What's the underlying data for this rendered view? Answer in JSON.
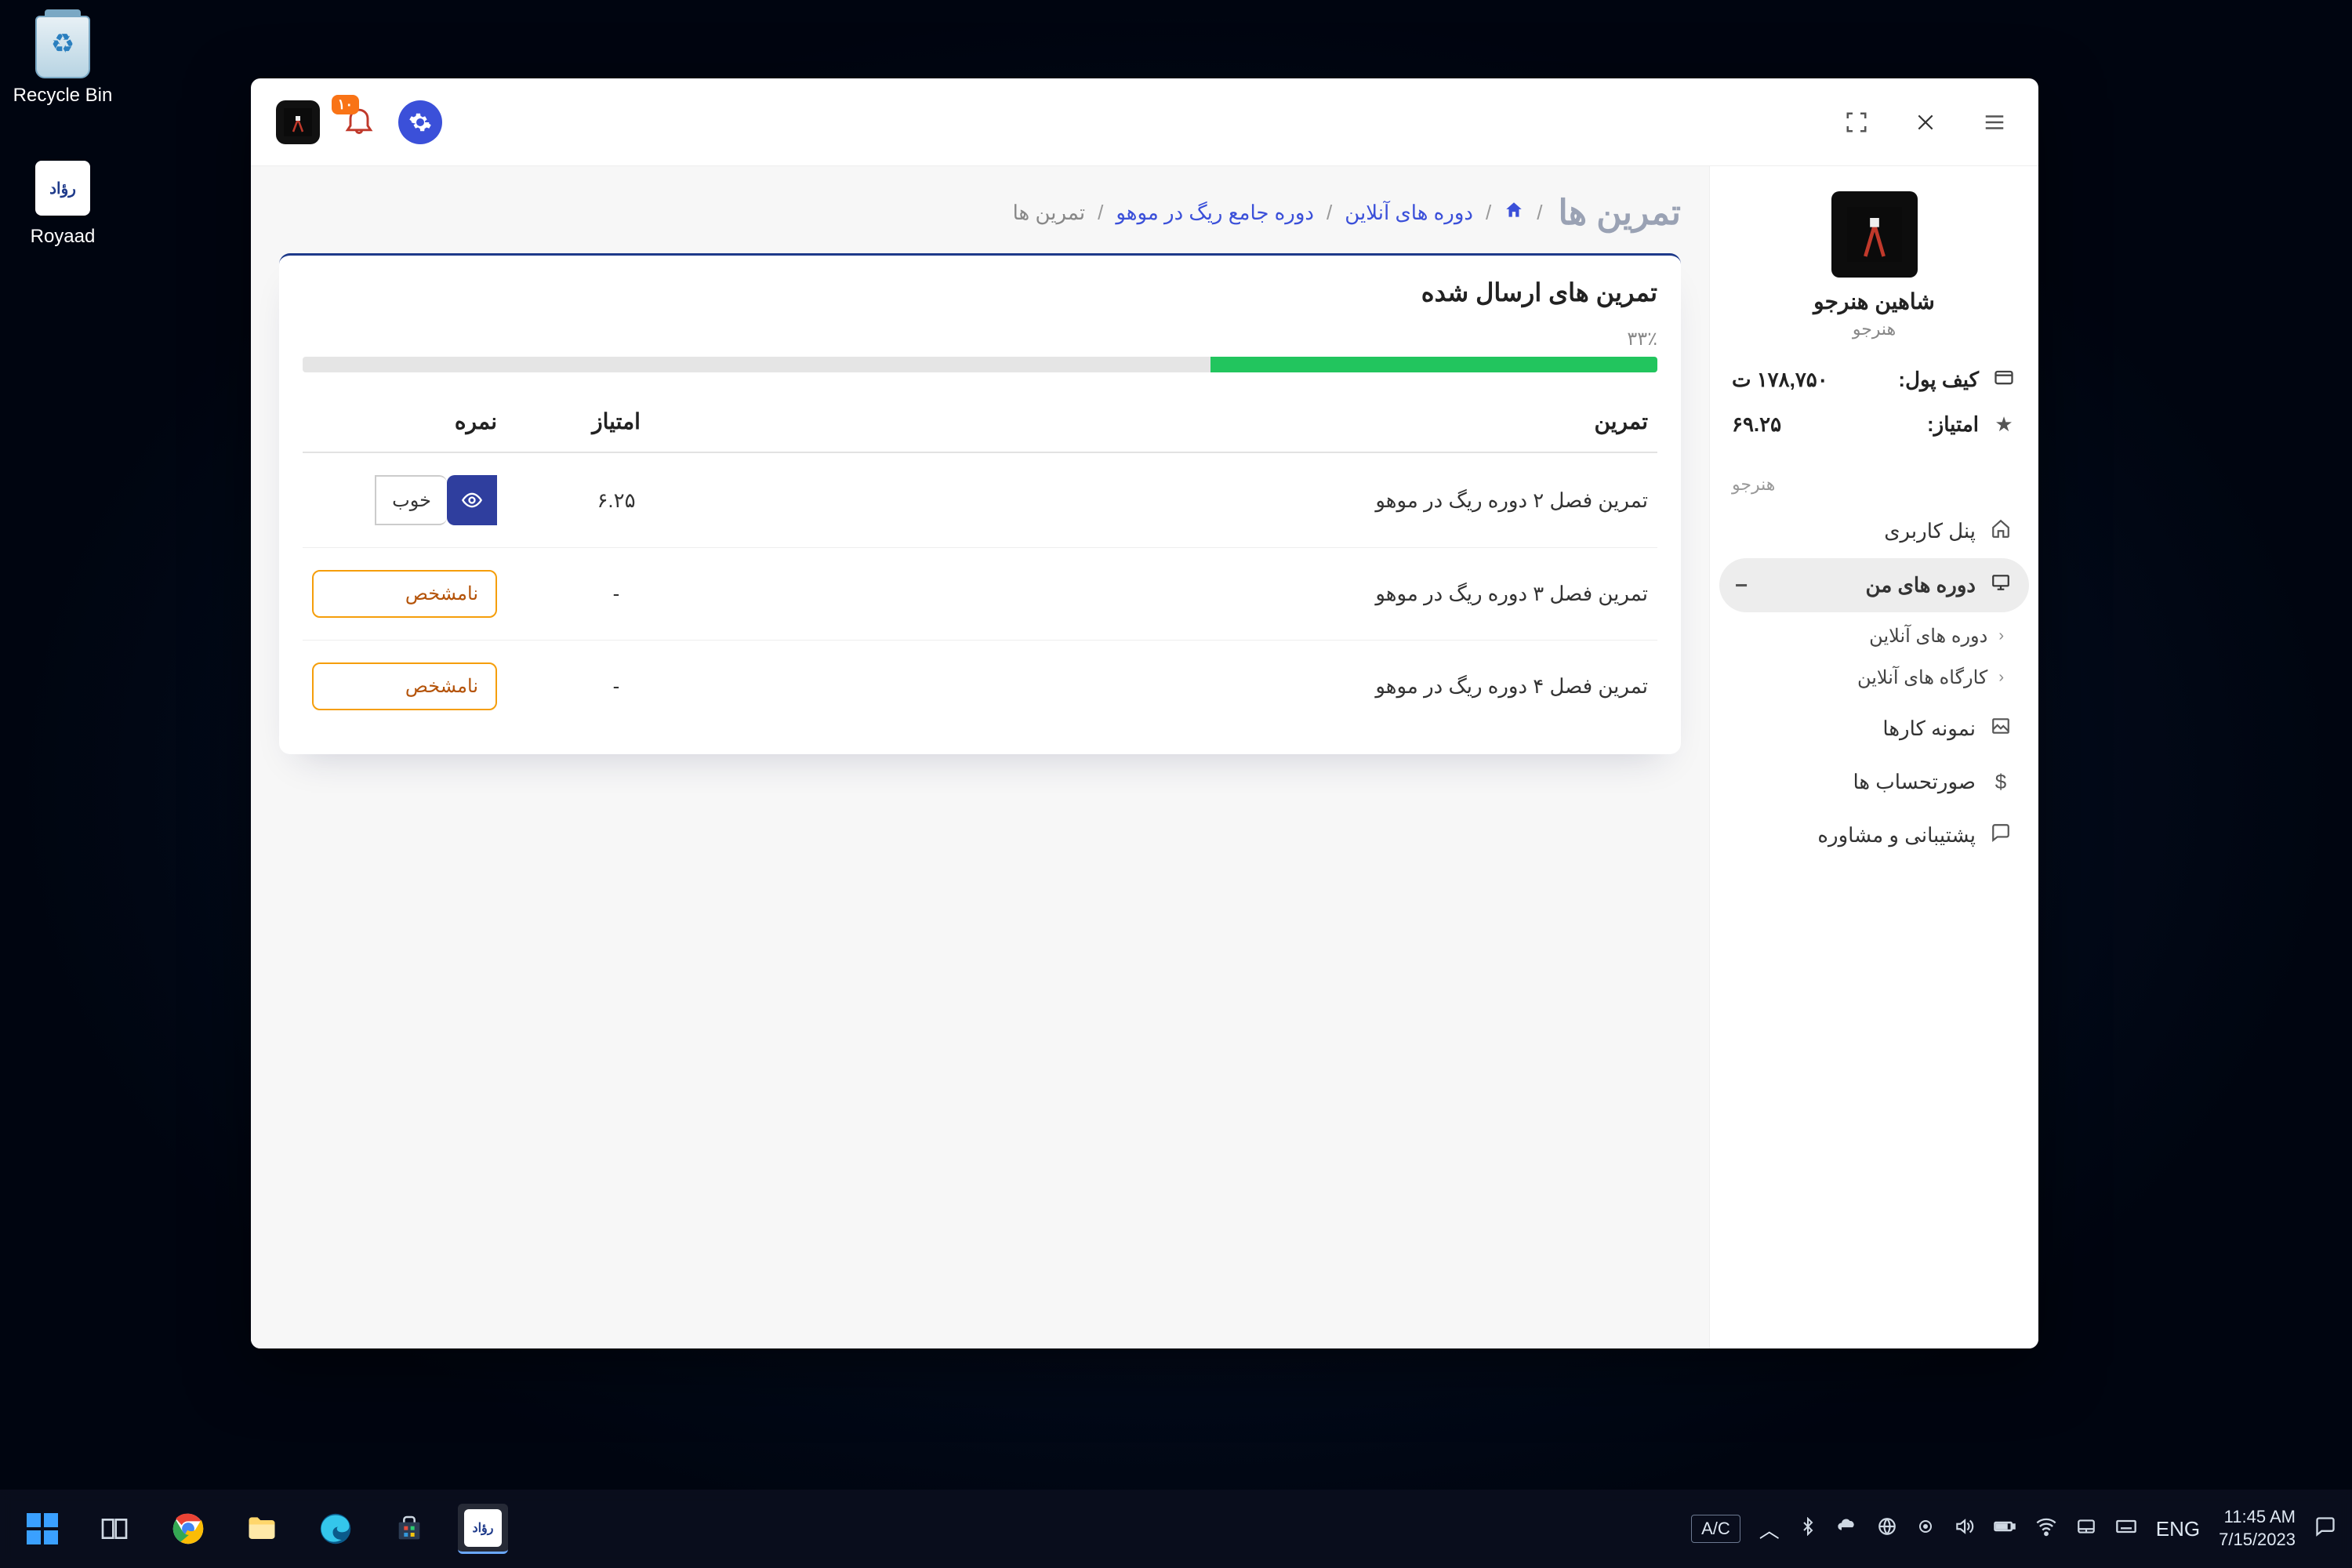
{
  "desktop": {
    "recycle_bin": "Recycle Bin",
    "royaad": "Royaad"
  },
  "topbar": {
    "notif_badge": "۱۰"
  },
  "profile": {
    "name": "شاهین هنرجو",
    "role": "هنرجو"
  },
  "stats": {
    "wallet_label": "کیف پول:",
    "wallet_value": "۱۷۸,۷۵۰ ت",
    "points_label": "امتیاز:",
    "points_value": "۶۹.۲۵"
  },
  "sidebar_section": "هنرجو",
  "menu": {
    "dashboard": "پنل کاربری",
    "my_courses": "دوره های من",
    "online_courses": "دوره های آنلاین",
    "online_workshops": "کارگاه های آنلاین",
    "portfolio": "نمونه کارها",
    "invoices": "صورتحساب ها",
    "support": "پشتیبانی و مشاوره"
  },
  "page": {
    "title": "تمرین ها",
    "breadcrumb": {
      "online_courses": "دوره های آنلاین",
      "course": "دوره جامع ریگ در موهو",
      "current": "تمرین ها"
    }
  },
  "card": {
    "title": "تمرین های ارسال شده",
    "progress_pct_label": "۳۳٪",
    "progress_pct": 33
  },
  "table": {
    "headers": {
      "name": "تمرین",
      "points": "امتیاز",
      "grade": "نمره"
    },
    "rows": [
      {
        "name": "تمرین فصل ۲ دوره ریگ در موهو",
        "points": "۶.۲۵",
        "grade": "خوب",
        "has_view": true
      },
      {
        "name": "تمرین فصل ۳ دوره ریگ در موهو",
        "points": "-",
        "grade": "نامشخص",
        "has_view": false
      },
      {
        "name": "تمرین فصل ۴ دوره ریگ در موهو",
        "points": "-",
        "grade": "نامشخص",
        "has_view": false
      }
    ]
  },
  "taskbar": {
    "ac": "A/C",
    "lang": "ENG",
    "time": "11:45 AM",
    "date": "7/15/2023"
  }
}
